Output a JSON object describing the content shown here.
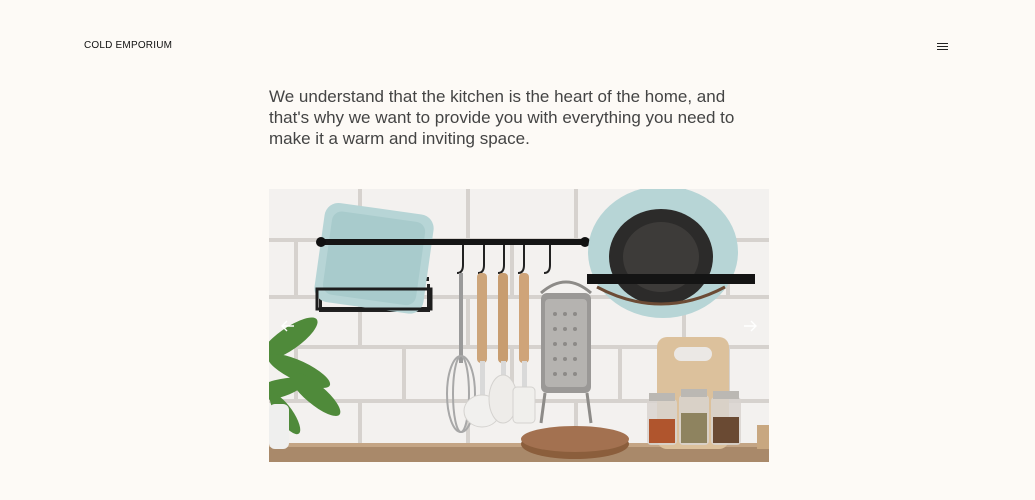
{
  "header": {
    "logo_text": "COLD EMPORIUM",
    "menu_icon": "hamburger-menu-icon"
  },
  "main": {
    "intro_text": "We understand that the kitchen is the heart of the home, and that's why we want to provide you with everything you need to make it a warm and inviting space."
  },
  "carousel": {
    "prev_icon": "arrow-left-icon",
    "next_icon": "arrow-right-icon"
  },
  "colors": {
    "background": "#fdfaf6",
    "text": "#444444",
    "logo_text": "#111111"
  }
}
